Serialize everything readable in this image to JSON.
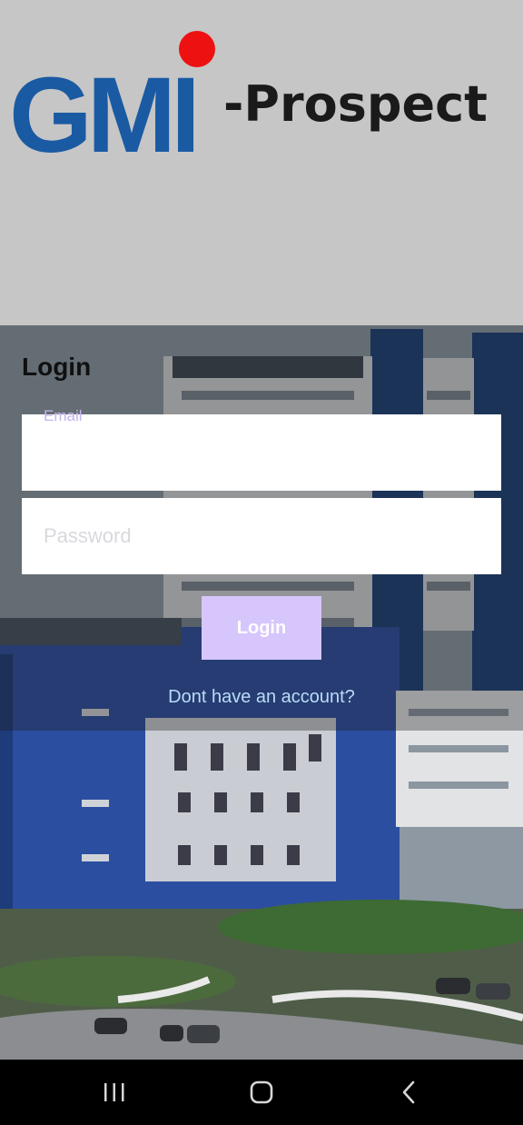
{
  "brand": {
    "logo_text": "GMI",
    "suffix_text": "-Prospect"
  },
  "login": {
    "title": "Login",
    "email_label": "Email",
    "email_value": "",
    "password_placeholder": "Password",
    "button_label": "Login",
    "signup_link": "Dont have an account?"
  },
  "navbar": {
    "icons": [
      "recent-apps-icon",
      "home-icon",
      "back-icon"
    ]
  },
  "colors": {
    "logo_blue": "#1a5aa3",
    "logo_dot_red": "#ee1111",
    "button_bg": "#d6c6fb",
    "link_color": "#b9dcf7"
  }
}
